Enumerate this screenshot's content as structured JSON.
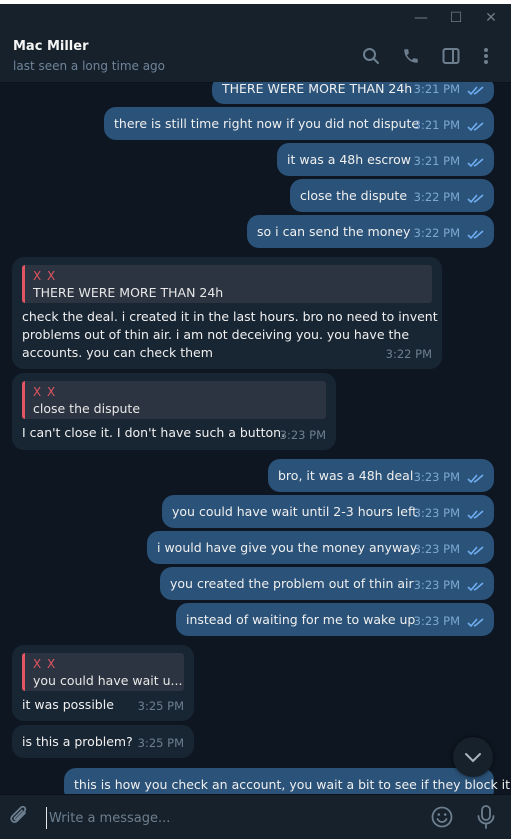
{
  "window": {
    "minimize": "—",
    "maximize": "☐",
    "close": "✕"
  },
  "header": {
    "title": "Mac Miller",
    "status": "last seen a long time ago"
  },
  "messages": [
    {
      "dir": "out",
      "text": "THERE WERE MORE THAN 24h",
      "time": "3:21 PM"
    },
    {
      "dir": "out",
      "text": "there is still time right now if you did not dispute",
      "time": "3:21 PM"
    },
    {
      "dir": "out",
      "text": "it was a 48h escrow",
      "time": "3:21 PM"
    },
    {
      "dir": "out",
      "text": "close the dispute",
      "time": "3:22 PM"
    },
    {
      "dir": "out",
      "text": "so i can send the money",
      "time": "3:22 PM"
    },
    {
      "dir": "in",
      "reply_name": "X X",
      "reply_text": "THERE WERE MORE THAN 24h",
      "lines": [
        "check the deal. i created it in the last hours. bro no need to invent",
        "problems out of thin air. i am not deceiving you. you have the",
        "accounts. you can check them"
      ],
      "time": "3:22 PM"
    },
    {
      "dir": "in",
      "reply_name": "X X",
      "reply_text": "close the dispute",
      "lines": [
        "I can't close it. I don't have such a button."
      ],
      "time": "3:23 PM"
    },
    {
      "dir": "out",
      "text": "bro, it was a 48h deal",
      "time": "3:23 PM"
    },
    {
      "dir": "out",
      "text": "you could have wait until 2-3 hours left",
      "time": "3:23 PM"
    },
    {
      "dir": "out",
      "text": "i would have give you the money anyway",
      "time": "3:23 PM"
    },
    {
      "dir": "out",
      "text": "you created the problem out of thin air",
      "time": "3:23 PM"
    },
    {
      "dir": "out",
      "text": "instead of waiting for me to wake up",
      "time": "3:23 PM"
    },
    {
      "dir": "in",
      "reply_name": "X X",
      "reply_text": "you could have wait u...",
      "lines": [
        "it was possible"
      ],
      "time": "3:25 PM"
    },
    {
      "dir": "in",
      "lines": [
        "is this a problem?"
      ],
      "time": "3:25 PM"
    },
    {
      "dir": "out",
      "text": "this is how you check an account, you wait a bit to see if they block it",
      "time": ""
    }
  ],
  "composer": {
    "placeholder": "Write a message..."
  },
  "colors": {
    "outgoing": "#2b5278",
    "incoming": "#182533",
    "background": "#0e1621",
    "accent": "#e05561",
    "check": "#6eaef0"
  }
}
